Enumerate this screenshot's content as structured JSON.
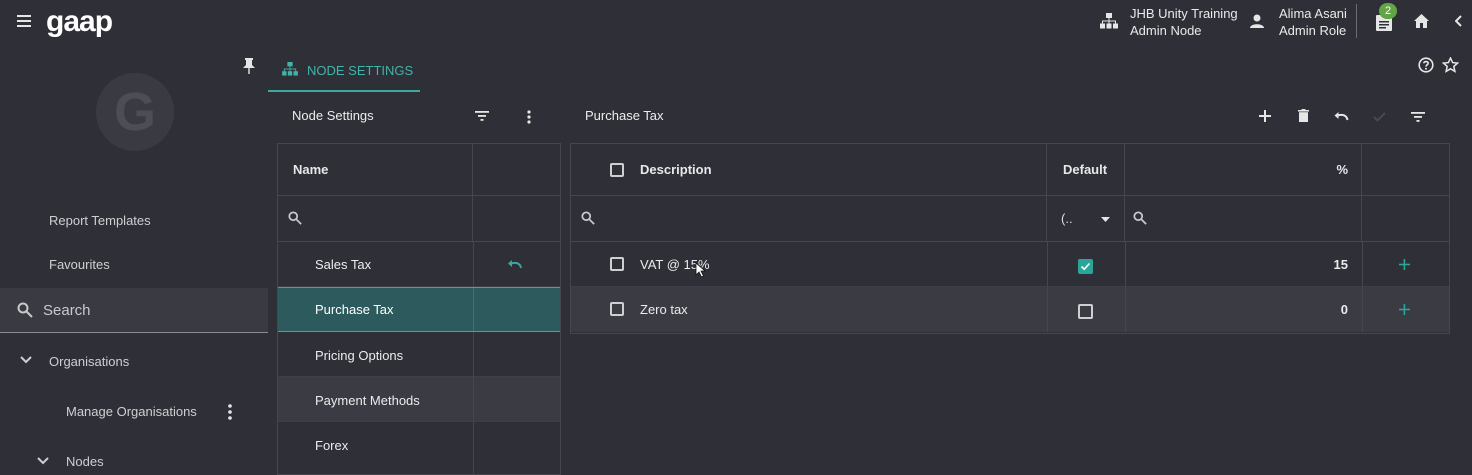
{
  "header": {
    "logo": "gaap",
    "node": {
      "name": "JHB Unity Training",
      "type": "Admin Node"
    },
    "user": {
      "name": "Alima Asani",
      "role": "Admin Role"
    },
    "notifications_count": "2"
  },
  "sidebar": {
    "items": [
      {
        "label": "Report Templates"
      },
      {
        "label": "Favourites"
      }
    ],
    "search_label": "Search",
    "organisations_label": "Organisations",
    "manage_organisations_label": "Manage Organisations",
    "nodes_label": "Nodes"
  },
  "tab": {
    "label": "NODE SETTINGS"
  },
  "left_panel": {
    "title": "Node Settings",
    "column_name": "Name",
    "rows": [
      {
        "label": "Sales Tax"
      },
      {
        "label": "Purchase Tax"
      },
      {
        "label": "Pricing Options"
      },
      {
        "label": "Payment Methods"
      },
      {
        "label": "Forex"
      }
    ]
  },
  "right_panel": {
    "title": "Purchase Tax",
    "columns": {
      "description": "Description",
      "default": "Default",
      "percent": "%"
    },
    "default_filter_value": "(..",
    "rows": [
      {
        "description": "VAT @ 15%",
        "default": true,
        "percent": "15"
      },
      {
        "description": "Zero tax",
        "default": false,
        "percent": "0"
      }
    ]
  },
  "colors": {
    "accent": "#42b3a8",
    "selected_row": "#2c5a5d",
    "badge": "#62a545"
  }
}
